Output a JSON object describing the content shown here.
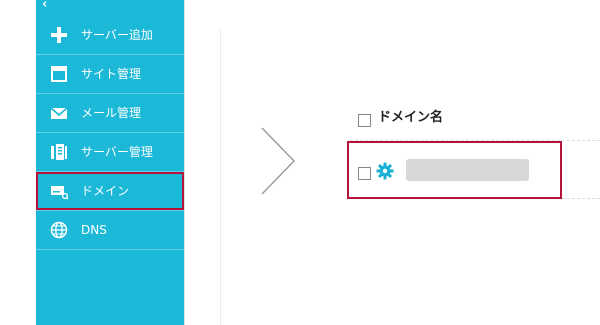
{
  "sidebar": {
    "collapse_icon": "chevron-left-icon",
    "items": [
      {
        "label": "サーバー追加",
        "icon": "plus-icon"
      },
      {
        "label": "サイト管理",
        "icon": "window-icon"
      },
      {
        "label": "メール管理",
        "icon": "envelope-icon"
      },
      {
        "label": "サーバー管理",
        "icon": "server-icon"
      },
      {
        "label": "ドメイン",
        "icon": "domain-card-icon",
        "active": true
      },
      {
        "label": "DNS",
        "icon": "globe-icon"
      }
    ]
  },
  "domain_table": {
    "header_label": "ドメイン名",
    "rows": [
      {
        "domain_name": "",
        "settings_icon": "gear-icon"
      }
    ]
  },
  "colors": {
    "sidebar_bg": "#1cb8d8",
    "highlight_border": "#b3123a",
    "gear": "#1ab0d6",
    "redacted_box": "#d7d7d7"
  }
}
